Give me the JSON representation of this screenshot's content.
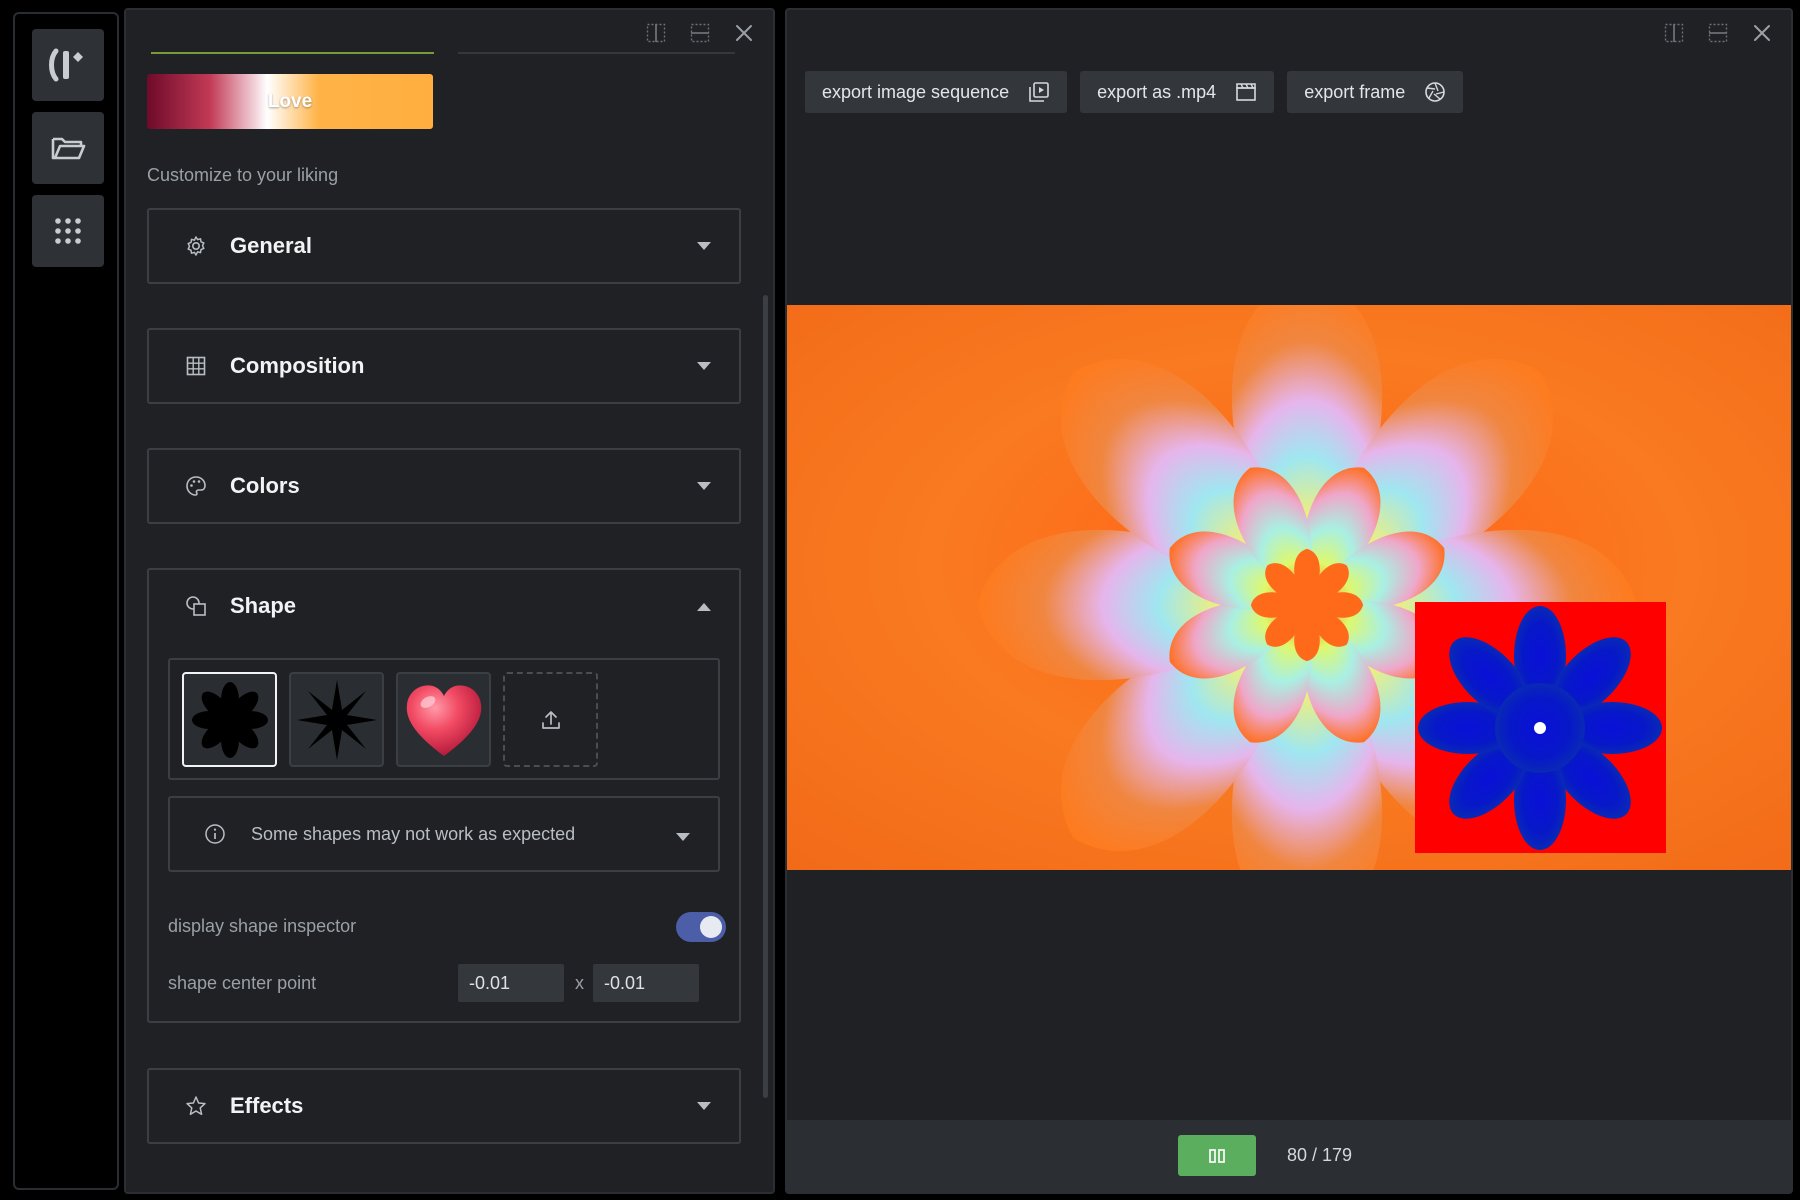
{
  "rail": {
    "items": [
      {
        "icon": "logo-icon"
      },
      {
        "icon": "folder-open-icon"
      },
      {
        "icon": "grid-dots-icon"
      }
    ]
  },
  "panel": {
    "preset_label": "Love",
    "subtitle": "Customize to your liking",
    "sections": {
      "general": "General",
      "composition": "Composition",
      "colors": "Colors",
      "shape": "Shape",
      "effects": "Effects"
    },
    "shape": {
      "thumbnails": [
        "flower-shape",
        "star-shape",
        "heart-shape",
        "upload"
      ],
      "selected_index": 0,
      "notice": "Some shapes may not work as expected",
      "inspector_label": "display shape inspector",
      "inspector_enabled": true,
      "center_label": "shape center point",
      "center_x": "-0.01",
      "center_y": "-0.01",
      "separator": "x"
    }
  },
  "preview": {
    "toolbar": {
      "export_sequence": "export image sequence",
      "export_mp4": "export as .mp4",
      "export_frame": "export frame"
    },
    "frame_counter": "80 / 179",
    "current_frame": 80,
    "total_frames": 179,
    "colors": {
      "inspector_bg": "#ff0000",
      "inspector_shape": "#0a10d8",
      "play_button": "#5aae5e",
      "toggle_on": "#4d5ea8"
    }
  }
}
